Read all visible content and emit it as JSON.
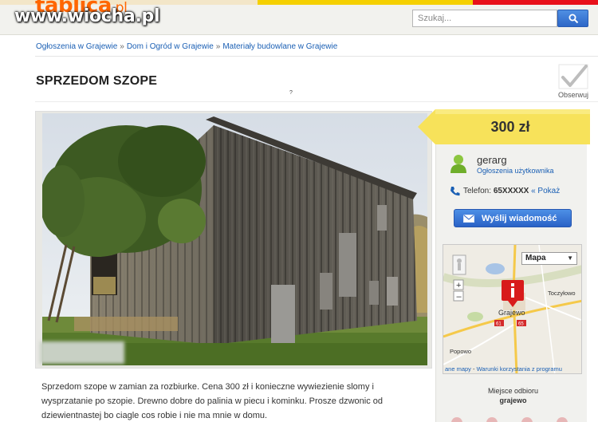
{
  "header": {
    "logo_main": "tablica",
    "logo_tld": ".pl",
    "watermark": "www.wiocha.pl",
    "search_placeholder": "Szukaj..."
  },
  "breadcrumb": [
    "Ogłoszenia w Grajewie",
    "Dom i Ogród w Grajewie",
    "Materiały budowlane w Grajewie"
  ],
  "listing": {
    "title": "SPRZEDOM SZOPE",
    "stray_mark": "?",
    "observe_label": "Obserwuj",
    "description": "Sprzedom szope w zamian za rozbiurke. Cena 300 zł i konieczne wywiezienie slomy i wysprzatanie po szopie. Drewno dobre do palinia w piecu i kominku. Prosze dzwonic od dziewientnastej bo ciagle cos robie i nie ma mnie w domu."
  },
  "sidebar": {
    "price": "300 zł",
    "username": "gerarg",
    "user_link": "Ogłoszenia użytkownika",
    "phone_label": "Telefon:",
    "phone_number": "65XXXXX",
    "phone_show": "« Pokaż",
    "message_button": "Wyślij wiadomość",
    "map_type": "Mapa",
    "map_footer_left": "ane mapy",
    "map_footer_sep": " - ",
    "map_footer_right": "Warunki korzystania z programu",
    "map_labels": {
      "town": "Grajewo",
      "north": "Toczyłowo",
      "southwest": "Popowo",
      "road1": "61",
      "road2": "65"
    },
    "pickup_label": "Miejsce odbioru",
    "pickup_value": "grajewo"
  },
  "colors": {
    "accent_orange": "#ff6600",
    "price_yellow": "#f7e25a",
    "button_blue": "#2e67c7",
    "link_blue": "#1a5fb4",
    "map_pin_red": "#d81b1b"
  },
  "icons": [
    "search-icon",
    "checkmark-icon",
    "user-icon",
    "phone-icon",
    "envelope-icon",
    "map-pin-icon",
    "pegman-icon"
  ]
}
